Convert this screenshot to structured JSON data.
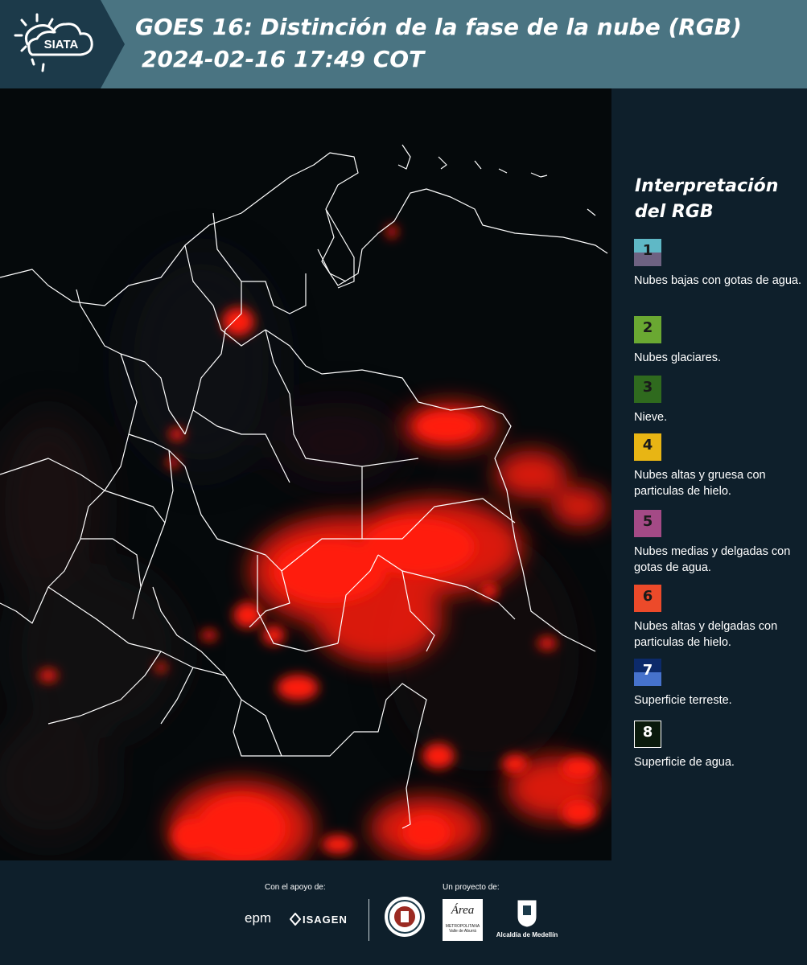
{
  "header": {
    "logo_text": "SIATA",
    "title_line1": "GOES 16: Distinción de la fase de la nube (RGB)",
    "title_line2": "2024-02-16 17:49 COT",
    "background_color": "#4a7482",
    "logo_background_color": "#1c3a4a"
  },
  "map": {
    "background_color": "#05090b",
    "cloud_color": "#ff1a10",
    "border_color": "#ffffff"
  },
  "legend": {
    "title": "Interpretación del RGB",
    "items": [
      {
        "number": "1",
        "label": "Nubes bajas con gotas de agua.",
        "color_top": "#5fb8c6",
        "color_bottom": "#6e6282"
      },
      {
        "number": "2",
        "label": "Nubes glaciares.",
        "color_top": "#6aa832",
        "color_bottom": "#6aa832"
      },
      {
        "number": "3",
        "label": "Nieve.",
        "color_top": "#2f6a1e",
        "color_bottom": "#2f6a1e"
      },
      {
        "number": "4",
        "label": "Nubes altas y gruesa con particulas de hielo.",
        "color_top": "#e8b514",
        "color_bottom": "#e8b514"
      },
      {
        "number": "5",
        "label": "Nubes medias y delgadas con gotas de agua.",
        "color_top": "#a44a86",
        "color_bottom": "#a44a86"
      },
      {
        "number": "6",
        "label": "Nubes altas y delgadas con particulas de hielo.",
        "color_top": "#ec4a2a",
        "color_bottom": "#ec4a2a"
      },
      {
        "number": "7",
        "label": "Superficie terreste.",
        "color_top": "#0c2a6a",
        "color_bottom": "#4672cc"
      },
      {
        "number": "8",
        "label": "Superficie de agua.",
        "color_top": "#0a1a0c",
        "color_bottom": "#0a1a0c"
      }
    ]
  },
  "footer": {
    "support_label": "Con el apoyo de:",
    "project_label": "Un proyecto de:",
    "sponsor_epm": "epm",
    "sponsor_isagen": "ISAGEN",
    "area_logo_text": "Área",
    "area_logo_sub1": "METROPOLITANA",
    "area_logo_sub2": "Valle de Aburrá",
    "alcaldia_text": "Alcaldía de Medellín"
  }
}
